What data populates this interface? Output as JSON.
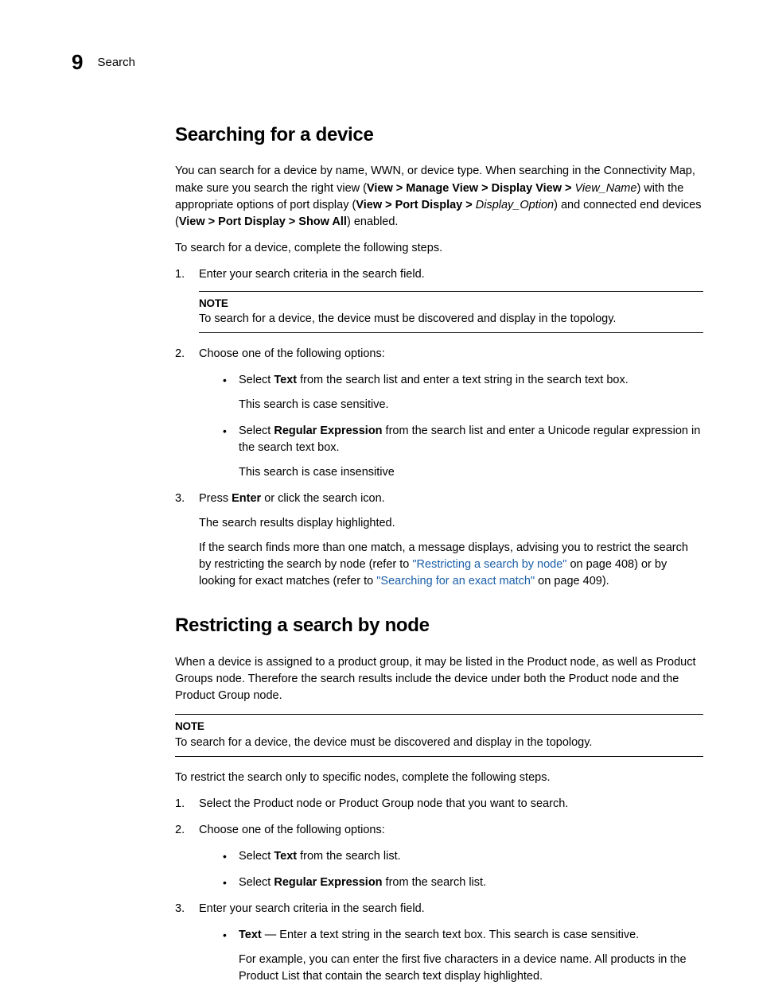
{
  "header": {
    "chapter_number": "9",
    "chapter_title": "Search"
  },
  "section1": {
    "heading": "Searching for a device",
    "p1_a": "You can search for a device by name, WWN, or device type. When searching in the Connectivity Map, make sure you search the right view (",
    "p1_b1": "View > Manage View > Display View >",
    "p1_b2": "View_Name",
    "p1_c": ") with the appropriate options of port display (",
    "p1_d1": "View > Port Display >",
    "p1_d2": "Display_Option",
    "p1_e": ") and connected end devices (",
    "p1_f": "View > Port Display > Show All",
    "p1_g": ") enabled.",
    "p2": "To search for a device, complete the following steps.",
    "step1": "Enter your search criteria in the search field.",
    "note1_label": "NOTE",
    "note1_text": "To search for a device, the device must be discovered and display in the topology.",
    "step2": "Choose one of the following options:",
    "bullet1_a": "Select ",
    "bullet1_b": "Text",
    "bullet1_c": " from the search list and enter a text string in the search text box.",
    "bullet1_sub": "This search is case sensitive.",
    "bullet2_a": "Select ",
    "bullet2_b": "Regular Expression",
    "bullet2_c": " from the search list and enter a Unicode regular expression in the search text box.",
    "bullet2_sub": "This search is case insensitive",
    "step3_a": "Press ",
    "step3_b": "Enter",
    "step3_c": " or click the search icon.",
    "step3_p1": "The search results display highlighted.",
    "step3_p2_a": "If the search finds more than one match, a message displays, advising you to restrict the search by restricting the search by node (refer to ",
    "step3_link1": "\"Restricting a search by node\"",
    "step3_p2_b": " on page 408) or by looking for exact matches (refer to ",
    "step3_link2": "\"Searching for an exact match\"",
    "step3_p2_c": " on page 409)."
  },
  "section2": {
    "heading": "Restricting a search by node",
    "p1": "When a device is assigned to a product group, it may be listed in the Product node, as well as Product Groups node. Therefore the search results include the device under both the Product node and the Product Group node.",
    "note_label": "NOTE",
    "note_text": "To search for a device, the device must be discovered and display in the topology.",
    "p2": "To restrict the search only to specific nodes, complete the following steps.",
    "step1": "Select the Product node or Product Group node that you want to search.",
    "step2": "Choose one of the following options:",
    "b1_a": "Select ",
    "b1_b": "Text",
    "b1_c": " from the search list.",
    "b2_a": "Select ",
    "b2_b": "Regular Expression",
    "b2_c": " from the search list.",
    "step3": "Enter your search criteria in the search field.",
    "b3_a": "Text",
    "b3_b": " — Enter a text string in the search text box. This search is case sensitive.",
    "b3_sub": "For example, you can enter the first five characters in a device name. All products in the Product List that contain the search text display highlighted."
  }
}
